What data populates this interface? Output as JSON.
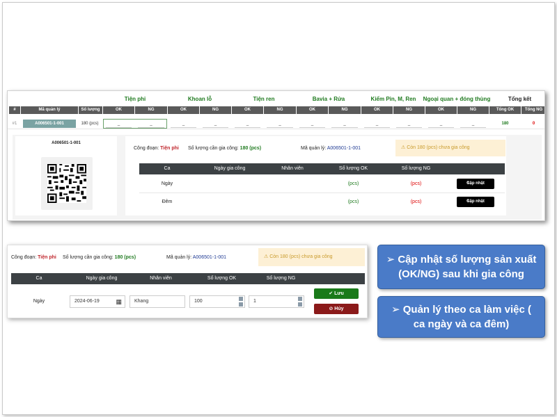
{
  "processes": [
    {
      "name": "Tiện phi"
    },
    {
      "name": "Khoan lỗ"
    },
    {
      "name": "Tiện ren"
    },
    {
      "name": "Bavia + Rửa"
    },
    {
      "name": "Kiểm Pin, M, Ren"
    },
    {
      "name": "Ngoại quan + đóng thùng"
    }
  ],
  "summary_label": "Tổng kết",
  "columns": {
    "index": "#",
    "code": "Mã quản lý",
    "qty": "Số lượng",
    "ok": "OK",
    "ng": "NG",
    "total_ok": "Tổng OK",
    "total_ng": "Tổng NG"
  },
  "row": {
    "index": "#1",
    "code": "A006501-1-001",
    "qty": "180 (pcs)",
    "dash": "_",
    "total_ok": "180",
    "total_ng": "0"
  },
  "detail": {
    "qr_code_label": "A006501-1-001",
    "stage_label": "Công đoạn:",
    "stage_value": "Tiện phi",
    "qty_label": "Số lượng cần gia công:",
    "qty_value": "180 (pcs)",
    "code_label": "Mã quản lý:",
    "code_value": "A006501-1-001",
    "warning": "Còn 180 (pcs) chưa gia công",
    "table_headers": [
      "Ca",
      "Ngày gia công",
      "Nhân viên",
      "Số lượng OK",
      "Số lượng NG"
    ],
    "rows": [
      {
        "shift": "Ngày",
        "ok": "(pcs)",
        "ng": "(pcs)",
        "button": "Cập nhật"
      },
      {
        "shift": "Đêm",
        "ok": "(pcs)",
        "ng": "(pcs)",
        "button": "Cập nhật"
      }
    ]
  },
  "edit_form": {
    "stage_label": "Công đoạn:",
    "stage_value": "Tiện phi",
    "qty_label": "Số lượng cần gia công:",
    "qty_value": "180 (pcs)",
    "code_label": "Mã quản lý:",
    "code_value": "A006501-1-001",
    "warning": "Còn 180 (pcs) chưa gia công",
    "table_headers": [
      "Ca",
      "Ngày gia công",
      "Nhân viên",
      "Số lượng OK",
      "Số lượng NG"
    ],
    "shift": "Ngày",
    "date_value": "2024-06-19",
    "employee_value": "Khang",
    "ok_value": "100",
    "ng_value": "1",
    "save_label": "Lưu",
    "cancel_label": "Hủy"
  },
  "callouts": [
    {
      "text": "Cập nhật số lượng sản xuất (OK/NG) sau khi gia công"
    },
    {
      "text": "Quản lý theo ca làm việc ( ca ngày và ca đêm)"
    }
  ],
  "colors": {
    "process_green": "#1f7a1f",
    "header_dark": "#5a5a5a",
    "ng_red": "#d00000",
    "callout_blue": "#4a7bc8",
    "save_green": "#1a7a1a",
    "cancel_red": "#8b1a1a"
  }
}
